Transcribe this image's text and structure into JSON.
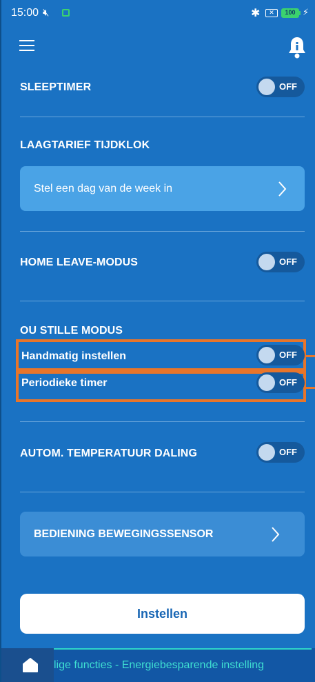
{
  "status_bar": {
    "time": "15:00",
    "battery": "100"
  },
  "header": {
    "menu_icon": "hamburger-menu-icon",
    "notification_icon": "bell-icon"
  },
  "settings": {
    "sleeptimer": {
      "label": "SLEEPTIMER",
      "state": "OFF"
    },
    "laagtarief": {
      "label": "LAAGTARIEF TIJDKLOK",
      "button": "Stel een dag van de week in"
    },
    "home_leave": {
      "label": "HOME LEAVE-MODUS",
      "state": "OFF"
    },
    "ou_stille": {
      "label": "OU STILLE MODUS",
      "manual": {
        "label": "Handmatig instellen",
        "state": "OFF"
      },
      "periodic": {
        "label": "Periodieke timer",
        "state": "OFF"
      }
    },
    "auto_temp": {
      "label": "AUTOM. TEMPERATUUR DALING",
      "state": "OFF"
    },
    "motion_sensor": {
      "label": "BEDIENING BEWEGINGSSENSOR"
    }
  },
  "primary_button": "Instellen",
  "bottom_bar": {
    "home_icon": "home-icon",
    "ticker": "lige functies - Energiebesparende instelling"
  },
  "colors": {
    "background": "#1a72c3",
    "highlight": "#e8752a",
    "accent_text": "#1866b4",
    "ticker": "#3fe0d2"
  }
}
